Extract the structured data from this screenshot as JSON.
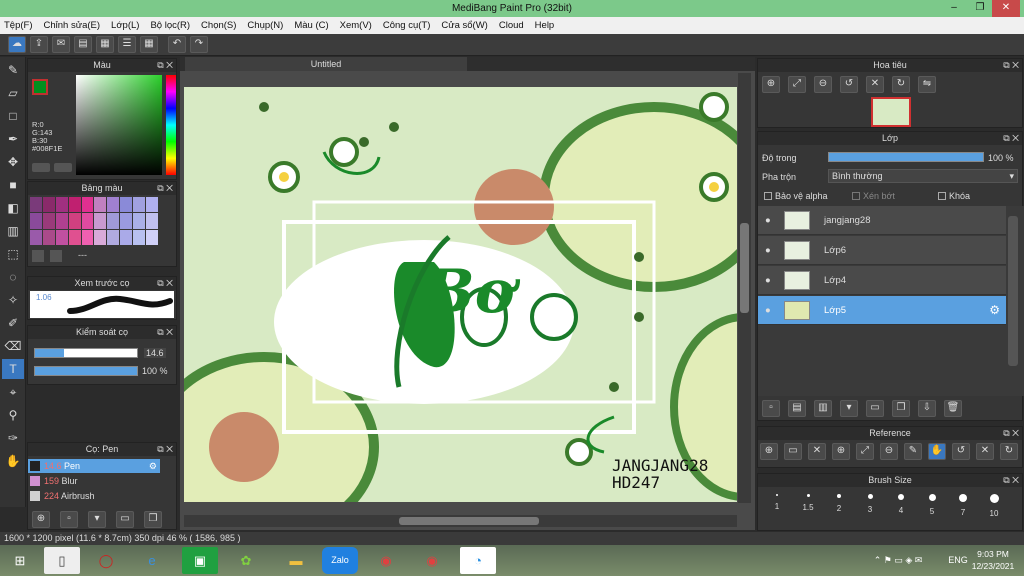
{
  "window": {
    "title": "MediBang Paint Pro (32bit)",
    "min": "–",
    "max": "❐",
    "close": "✕"
  },
  "menu": [
    "Tệp(F)",
    "Chỉnh sửa(E)",
    "Lớp(L)",
    "Bộ lọc(R)",
    "Chọn(S)",
    "Chụp(N)",
    "Màu (C)",
    "Xem(V)",
    "Công cụ(T)",
    "Cửa sổ(W)",
    "Cloud",
    "Help"
  ],
  "panels": {
    "color": {
      "title": "Màu",
      "r": "R:0",
      "g": "G:143",
      "b": "B:30",
      "hex": "#008F1E",
      "fg": "#008F1E"
    },
    "palette": {
      "title": "Bảng màu",
      "extra": "---",
      "swatches": [
        "#7a3a7a",
        "#8a2a6a",
        "#a03080",
        "#c02070",
        "#e03090",
        "#c080c0",
        "#a080d0",
        "#8a8ad8",
        "#a0a0e0",
        "#b0b0f0",
        "#8a4a9a",
        "#9a3a7a",
        "#b04090",
        "#d04080",
        "#e04aa0",
        "#c89ad0",
        "#a09ad8",
        "#9a9ae0",
        "#aab0e8",
        "#c0c0f0",
        "#9a5aaa",
        "#aa4a8a",
        "#c050a0",
        "#e05090",
        "#f060b0",
        "#d8aad8",
        "#b0aae0",
        "#aaaae8",
        "#b8c0f0",
        "#d0d0f8"
      ]
    },
    "brushPreview": {
      "title": "Xem trước cọ",
      "size": "1.06"
    },
    "brushControl": {
      "title": "Kiểm soát cọ",
      "size": "14.6",
      "opacity": "100 %",
      "sizeFrac": 0.28,
      "opacityFrac": 1.0
    },
    "brushList": {
      "title": "Cọ: Pen",
      "items": [
        {
          "size": "14.6",
          "name": "Pen",
          "color": "#222"
        },
        {
          "size": "159",
          "name": "Blur",
          "color": "#d090d0"
        },
        {
          "size": "224",
          "name": "Airbrush",
          "color": "#d0d0d0"
        }
      ]
    }
  },
  "canvas": {
    "tab": "Untitled",
    "signature1": "JANGJANG28",
    "signature2": "HD247",
    "lettering": "Bơ"
  },
  "navigator": {
    "title": "Hoa tiêu"
  },
  "layers": {
    "title": "Lớp",
    "opacityLabel": "Độ trong",
    "opacityValue": "100 %",
    "opacityFrac": 1.0,
    "blendLabel": "Pha trộn",
    "blendValue": "Bình thường",
    "protectAlpha": "Bảo vệ alpha",
    "clipping": "Xén bớt",
    "lock": "Khóa",
    "items": [
      {
        "name": "jangjang28",
        "selected": false
      },
      {
        "name": "Lớp6",
        "selected": false
      },
      {
        "name": "Lớp4",
        "selected": false
      },
      {
        "name": "Lớp5",
        "selected": true
      }
    ]
  },
  "reference": {
    "title": "Reference"
  },
  "brushSize": {
    "title": "Brush Size",
    "sizes": [
      "1",
      "1.5",
      "2",
      "3",
      "4",
      "5",
      "7",
      "10"
    ]
  },
  "status": {
    "text": "1600 * 1200 pixel   (11.6 * 8.7cm)   350 dpi   46 %   ( 1586, 985 )"
  },
  "taskbar": {
    "lang": "ENG",
    "time": "9:03 PM",
    "date": "12/23/2021"
  }
}
